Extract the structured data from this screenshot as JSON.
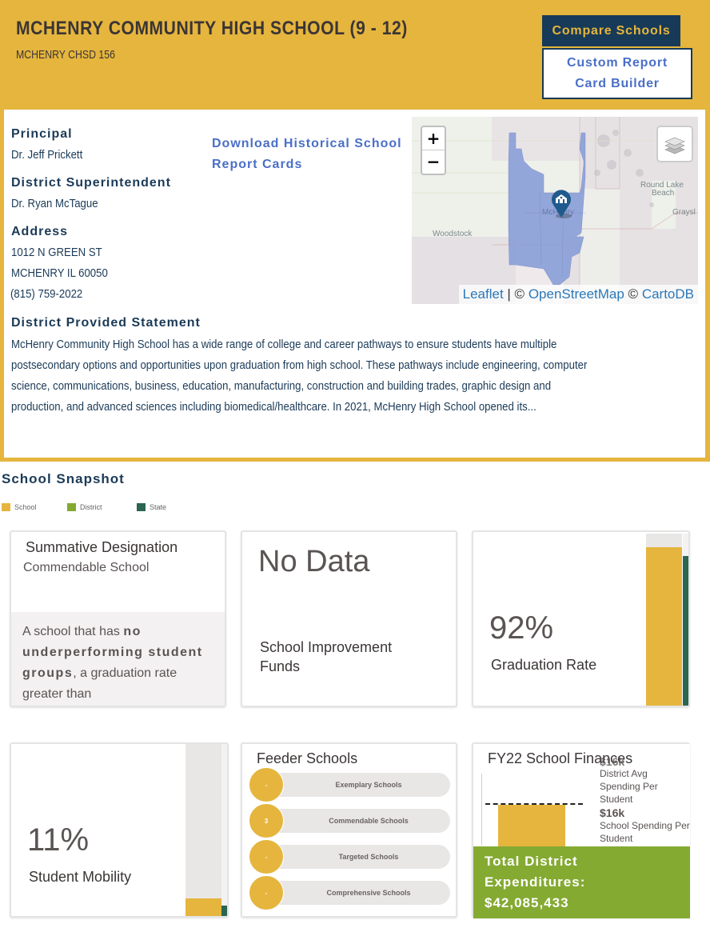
{
  "header": {
    "school_name": "MCHENRY COMMUNITY HIGH SCHOOL (9 - 12)",
    "district_name": "MCHENRY CHSD 156",
    "compare_button": "Compare Schools",
    "custom_report_button_line1": "Custom Report",
    "custom_report_button_line2": "Card Builder"
  },
  "info": {
    "principal_label": "Principal",
    "principal_name": "Dr. Jeff Prickett",
    "superintendent_label": "District Superintendent",
    "superintendent_name": "Dr. Ryan McTague",
    "address_label": "Address",
    "address_line1": "1012 N GREEN ST",
    "address_line2": "MCHENRY IL 60050",
    "phone": "(815) 759-2022",
    "download_link_line1": "Download Historical School",
    "download_link_line2": "Report Cards",
    "statement_label": "District Provided Statement",
    "statement_text": "McHenry Community High School has a wide range of college and career pathways to ensure students have multiple postsecondary options and opportunities upon graduation from high school. These pathways include engineering, computer science, communications, business, education, manufacturing, construction and building trades, graphic design and production, and advanced sciences including biomedical/healthcare. In 2021, McHenry High School opened its..."
  },
  "map": {
    "zoom_in": "+",
    "zoom_out": "−",
    "layers_icon": "layers-icon",
    "marker_icon": "school-marker-icon",
    "place_labels": [
      "Woodstock",
      "McHenry",
      "Round Lake",
      "Beach",
      "Graysl"
    ],
    "attribution_leaflet": "Leaflet",
    "attribution_sep": " | © ",
    "attribution_osm": "OpenStreetMap",
    "attribution_sep2": " © ",
    "attribution_carto": "CartoDB"
  },
  "snapshot": {
    "title": "School Snapshot",
    "legend": [
      {
        "label": "School",
        "color": "#e5b53e"
      },
      {
        "label": "District",
        "color": "#84aa32"
      },
      {
        "label": "State",
        "color": "#2a6650"
      }
    ],
    "summative": {
      "title": "Summative Designation",
      "value": "Commendable School",
      "desc_pre": "A school that has ",
      "desc_bold1": "no underperforming student groups",
      "desc_mid": ", a graduation rate greater than"
    },
    "improvement": {
      "value": "No Data",
      "label_line1": "School Improvement",
      "label_line2": "Funds"
    },
    "graduation": {
      "value": "92%",
      "label": "Graduation Rate",
      "school_pct": 92,
      "state_pct": 87
    },
    "mobility": {
      "value": "11%",
      "label": "Student Mobility",
      "school_pct": 11,
      "state_pct": 7
    },
    "feeder": {
      "title": "Feeder Schools",
      "rows": [
        {
          "count": "-",
          "label": "Exemplary Schools"
        },
        {
          "count": "3",
          "label": "Commendable Schools"
        },
        {
          "count": "-",
          "label": "Targeted Schools"
        },
        {
          "count": "-",
          "label": "Comprehensive Schools"
        }
      ]
    },
    "finances": {
      "title": "FY22 School Finances",
      "district_avg_value": "$16k",
      "district_avg_label": "District Avg Spending Per Student",
      "school_value": "$16k",
      "school_label": "School Spending Per Student",
      "total_label_line1": "Total District",
      "total_label_line2": "Expenditures:",
      "total_value": "$42,085,433"
    }
  }
}
